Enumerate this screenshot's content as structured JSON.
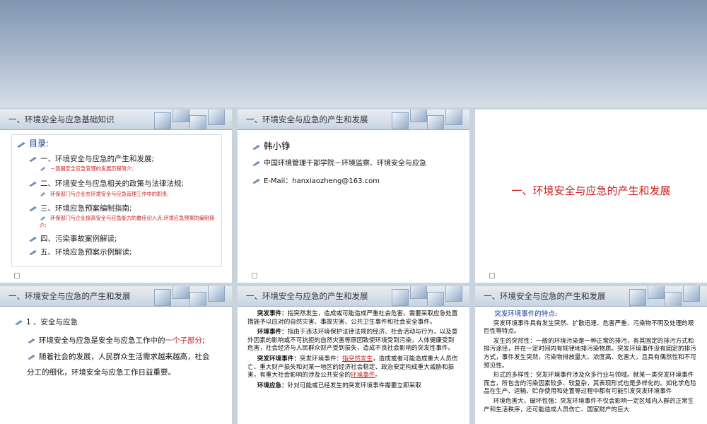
{
  "colors": {
    "accent_red": "#cc1f1f",
    "header_text": "#333333",
    "title_blue": "#1a3f9a"
  },
  "icons": {
    "bullet": "pen-bullet-icon",
    "slide_marker": "slide-marker-icon"
  },
  "slides": {
    "s1": {
      "header": "一、环境安全与应急基础知识",
      "toc_title": "目录:",
      "items": [
        {
          "label": "一、环境安全与应急的产生和发展;",
          "sub": "－我国安全应急管理的发展历程简介;"
        },
        {
          "label": "二、环境安全与应急相关的政策与法律法规;",
          "sub": "环保部门与企业在环境安全与应急管理工作中的职责;"
        },
        {
          "label": "三、环境应急预案编制指南;",
          "sub": "环保部门与企业提高安全与应急能力的最佳切入点:环境应急预案的编制简介;"
        },
        {
          "label": "四、污染事故案例解读;"
        },
        {
          "label": "五、环境应急预案示例解读;"
        }
      ]
    },
    "s2": {
      "header": "一、环境安全与应急的产生和发展",
      "name": "韩小铮",
      "org": "中国环境管理干部学院－环境监察、环境安全与应急",
      "email": "E-Mail：hanxiaozheng@163.com"
    },
    "s3": {
      "title": "一、环境安全与应急的产生和发展"
    },
    "s4": {
      "header": "一、环境安全与应急的产生和发展",
      "heading": "1 、安全与应急",
      "b1_pre": "环境安全与应急是安全与应急工作中的",
      "b1_red": "一个子部分",
      "b1_post": ";",
      "b2_line1": "随着社会的发展，人民群众生活需求越来越高，社会",
      "b2_line2": "分工的细化，环境安全与应急工作日益重要。"
    },
    "s5": {
      "header": "一、环境安全与应急的产生和发展",
      "p1_lead": "突发事件：",
      "p1_text": "指突然发生，造成或可能造成严重社会危害，需要采取应急处置措施予以应对的自然灾害、事故灾害、公共卫生事件和社会安全事件。",
      "p2_lead": "环境事件：",
      "p2_text": "指由于违法环境保护法律法规的经济、社会活动与行为，以及意外因素的影响或不可抗拒的自然灾害等原因致使环境受到污染，人体健康受到危害，社会经济与人民群众财产受到损失，造成不良社会影响的突发性事件。",
      "p3_lead": "突发环境事件：",
      "p3_a": "突发环境事件：",
      "p3_link1": "指突然发生",
      "p3_b": "，造成或者可能造成重大人员伤亡、重大财产损失和对某一地区的经济社会稳定、政治安定构成重大威胁和损害，有重大社会影响的涉及公共安全的",
      "p3_link2": "环境事件",
      "p3_c": "。",
      "p4_lead": "环境应急：",
      "p4_text": "针对可能或已经发生的突发环境事件需要立即采取"
    },
    "s6": {
      "header": "一、环境安全与应急的产生和发展",
      "title": "突发环境事件的特点:",
      "p1": "突发环境事件具有发生突然、扩散迅速、危害严重、污染物不明及处理的艰巨性等特点。",
      "p2": "发生的突然性：一般的环境污染是一种正常的排污，有其固定的排污方式和排污途径，并在一定时间内有规律地排污染物质。突发环境事件没有固定的排污方式，事件发生突然，污染物排放量大、浓度高、危害大，且具有偶然性和不可预见性。",
      "p3": "形式的多样性：突发环境事件涉及众多行业与领域。就某一类突发环境事件而言，所包含的污染因素较多、较复杂，其表现形式也是多样化的。如化学危险品在生产、运输、贮存使用和处置等过程中都有可能引发突发环境事件",
      "p4": "环境危害大、破坏性强：突发环境事件不仅会影响一定区域内人群的正常生产和生活秩序，还可能造成人员伤亡、国家财产的巨大"
    }
  }
}
